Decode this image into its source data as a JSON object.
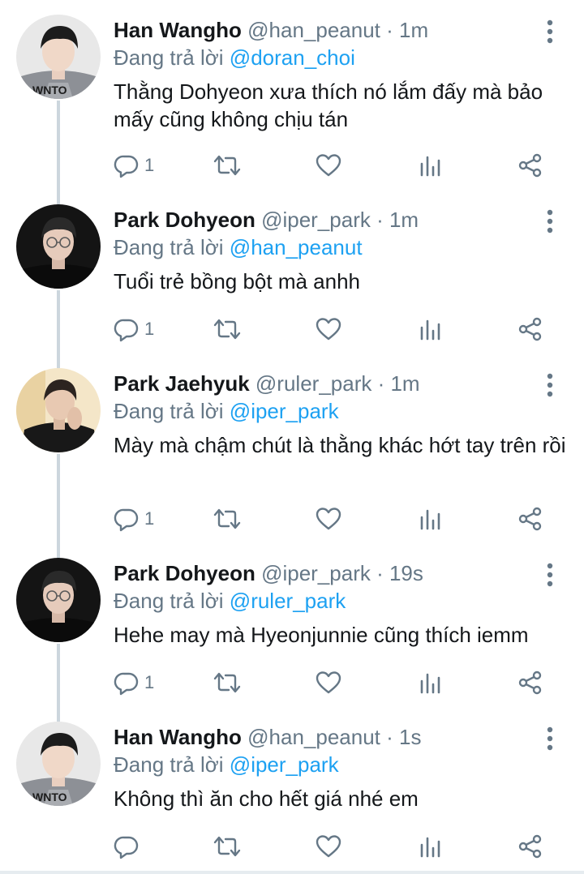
{
  "thread": {
    "tweets": [
      {
        "name": "Han Wangho",
        "handle": "@han_peanut",
        "time": "· 1m",
        "reply_prefix": "Đang trả lời",
        "reply_to": "@doran_choi",
        "text": "Thằng Dohyeon xưa thích nó lắm đấy mà bảo mấy cũng không chịu tán",
        "reply_count": "1",
        "avatar_icon": "avatar-han-wangho"
      },
      {
        "name": "Park Dohyeon",
        "handle": "@iper_park",
        "time": "· 1m",
        "reply_prefix": "Đang trả lời",
        "reply_to": "@han_peanut",
        "text": "Tuổi trẻ bồng bột mà anhh",
        "reply_count": "1",
        "avatar_icon": "avatar-park-dohyeon"
      },
      {
        "name": "Park Jaehyuk",
        "handle": "@ruler_park",
        "time": "· 1m",
        "reply_prefix": "Đang trả lời",
        "reply_to": "@iper_park",
        "text": "Mày mà chậm chút là thằng khác hớt tay trên rồi",
        "reply_count": "1",
        "avatar_icon": "avatar-park-jaehyuk"
      },
      {
        "name": "Park Dohyeon",
        "handle": "@iper_park",
        "time": "· 19s",
        "reply_prefix": "Đang trả lời",
        "reply_to": "@ruler_park",
        "text": "Hehe may mà Hyeonjunnie cũng thích iemm",
        "reply_count": "1",
        "avatar_icon": "avatar-park-dohyeon"
      },
      {
        "name": "Han Wangho",
        "handle": "@han_peanut",
        "time": "· 1s",
        "reply_prefix": "Đang trả lời",
        "reply_to": "@iper_park",
        "text": "Không thì ăn cho hết giá nhé em",
        "reply_count": "",
        "avatar_icon": "avatar-han-wangho"
      }
    ]
  },
  "icons": {
    "reply": "reply-icon",
    "retweet": "retweet-icon",
    "like": "heart-icon",
    "analytics": "analytics-icon",
    "share": "share-icon",
    "more": "more-vertical-icon"
  },
  "colors": {
    "link": "#1da1f2",
    "muted": "#657786",
    "text": "#14171a",
    "thread_line": "#ccd6dd"
  }
}
